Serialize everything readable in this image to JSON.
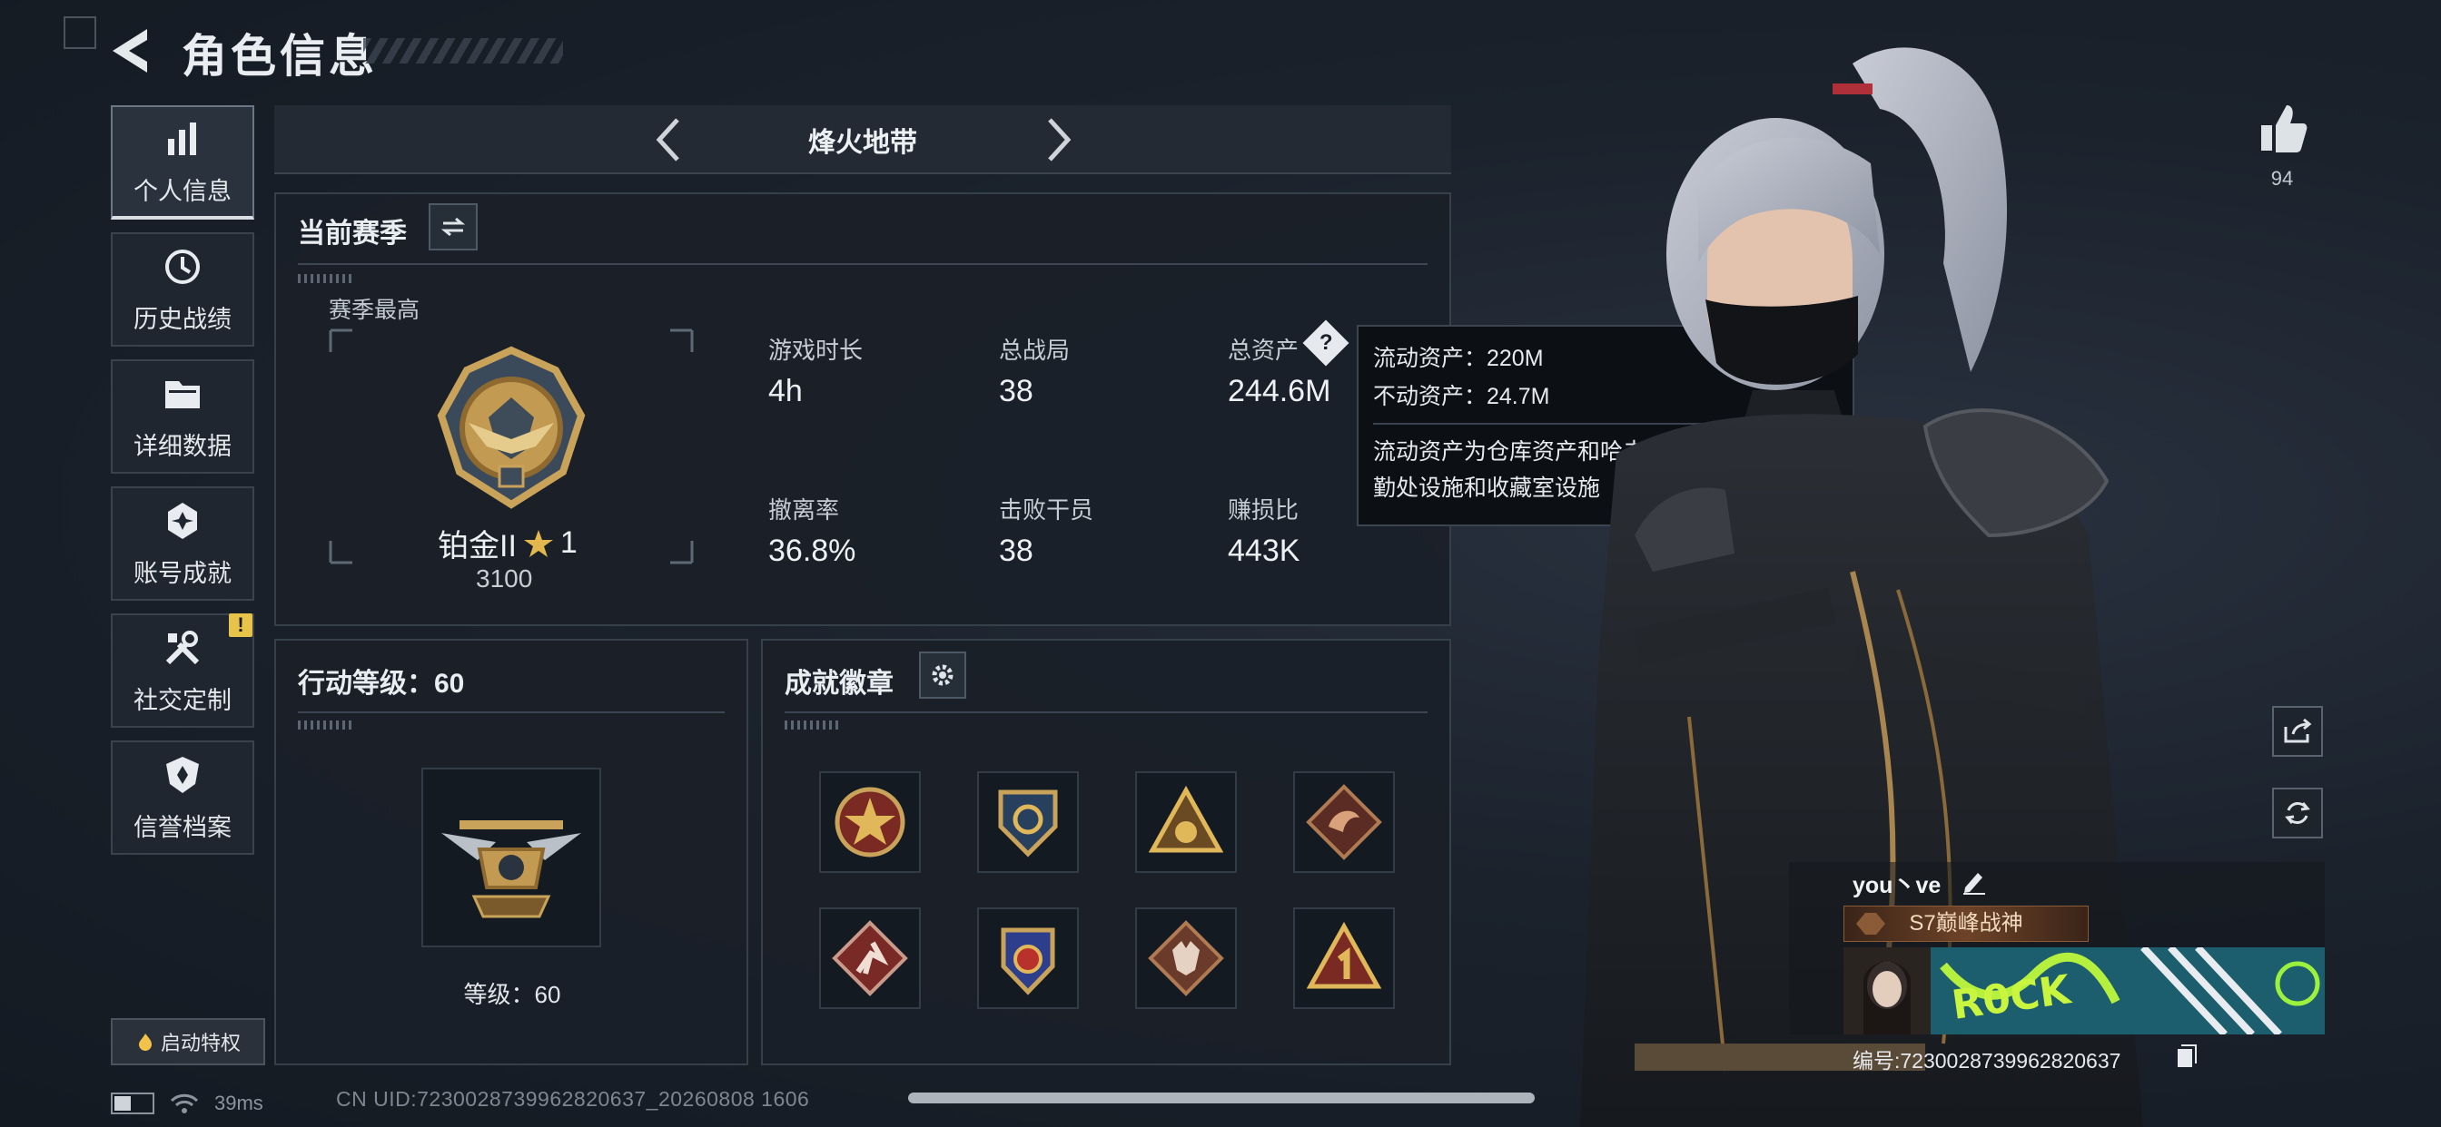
{
  "header": {
    "title": "角色信息"
  },
  "sidebar": {
    "items": [
      {
        "label": "个人信息",
        "icon": "bar-chart-icon"
      },
      {
        "label": "历史战绩",
        "icon": "history-clock-icon"
      },
      {
        "label": "详细数据",
        "icon": "folder-icon"
      },
      {
        "label": "账号成就",
        "icon": "achievement-icon"
      },
      {
        "label": "社交定制",
        "icon": "tools-icon"
      },
      {
        "label": "信誉档案",
        "icon": "credit-shield-icon"
      }
    ],
    "warning_badge": "!",
    "privilege_button": "启动特权"
  },
  "status": {
    "ping": "39ms",
    "uid_line": "CN UID:7230028739962820637_20260808 1606"
  },
  "mode": {
    "title": "烽火地带"
  },
  "season": {
    "title": "当前赛季",
    "best_label": "赛季最高",
    "rank": {
      "name": "铂金II",
      "stars": "1",
      "points": "3100"
    },
    "stats": [
      {
        "label": "游戏时长",
        "value": "4h"
      },
      {
        "label": "总战局",
        "value": "38"
      },
      {
        "label": "总资产",
        "value": "244.6M"
      },
      {
        "label": "撤离率",
        "value": "36.8%"
      },
      {
        "label": "击败干员",
        "value": "38"
      },
      {
        "label": "赚损比",
        "value": "443K"
      }
    ],
    "help_glyph": "?"
  },
  "tooltip": {
    "liquid": "流动资产：220M",
    "fixed": "不动资产：24.7M",
    "description": "流动资产为仓库资产和哈夫币，不动资产为特勤处设施和收藏室设施"
  },
  "action_level": {
    "title": "行动等级：60",
    "level_text": "等级：60"
  },
  "badges": {
    "title": "成就徽章",
    "items": [
      "star-badge-icon",
      "shield-badge-icon",
      "triangle-badge-icon",
      "dragon-badge-icon",
      "runner-badge-icon",
      "emblem-badge-icon",
      "wolf-badge-icon",
      "number-one-badge-icon"
    ]
  },
  "right": {
    "likes": "94"
  },
  "profile_card": {
    "name": "you丶ve",
    "title": "S7巅峰战神",
    "id_text": "编号:7230028739962820637"
  },
  "colors": {
    "accent_gold": "#c9a35a",
    "panel_bg": "#1a2028",
    "text_main": "#e9edf1",
    "warning": "#e8c34a"
  }
}
